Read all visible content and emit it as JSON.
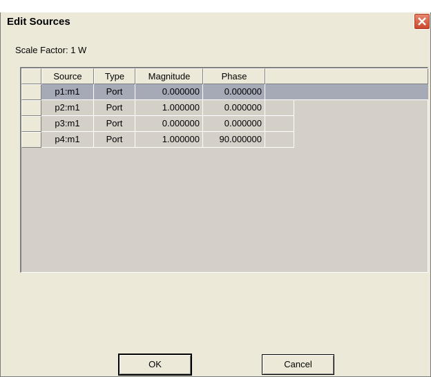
{
  "window": {
    "title": "Edit Sources",
    "close_label": "X"
  },
  "scale_factor_text": "Scale Factor: 1 W",
  "table": {
    "columns": [
      "Source",
      "Type",
      "Magnitude",
      "Phase"
    ],
    "rows": [
      [
        "p1:m1",
        "Port",
        "0.000000",
        "0.000000"
      ],
      [
        "p2:m1",
        "Port",
        "1.000000",
        "0.000000"
      ],
      [
        "p3:m1",
        "Port",
        "0.000000",
        "0.000000"
      ],
      [
        "p4:m1",
        "Port",
        "1.000000",
        "90.000000"
      ]
    ],
    "selected_row": 0
  },
  "buttons": {
    "ok": "OK",
    "cancel": "Cancel"
  },
  "colors": {
    "selected_row": "#a6aab7",
    "dialog_bg": "#ece9d8",
    "grid_bg": "#d4d0c8"
  }
}
